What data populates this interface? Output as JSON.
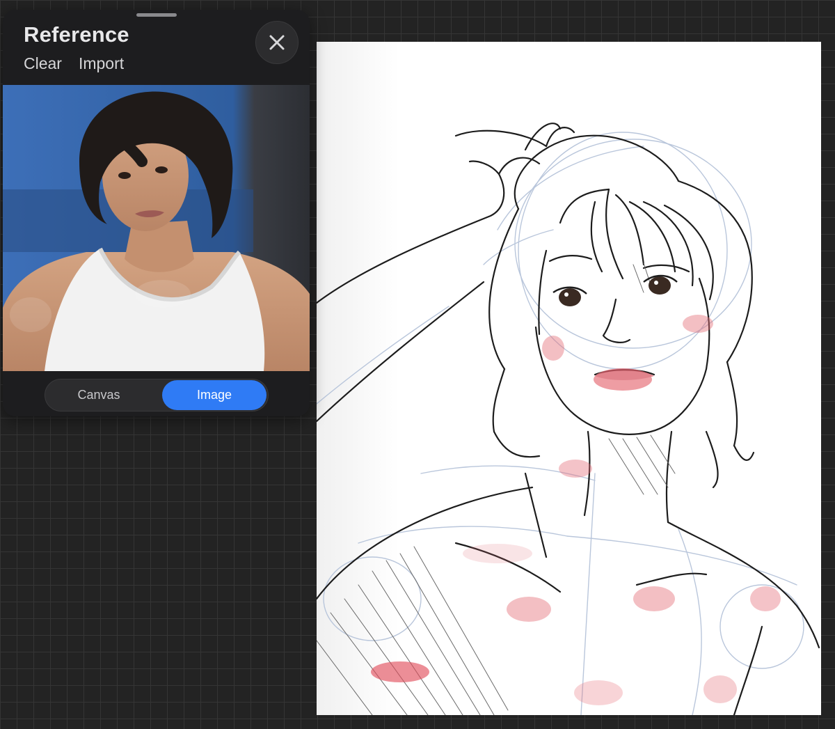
{
  "reference_panel": {
    "title": "Reference",
    "actions": [
      {
        "label": "Clear"
      },
      {
        "label": "Import"
      }
    ],
    "close_icon": "close-icon",
    "segmented_control": {
      "options": [
        {
          "label": "Canvas",
          "selected": false
        },
        {
          "label": "Image",
          "selected": true
        }
      ]
    }
  },
  "colors": {
    "accent": "#2f7bf5",
    "workspace_background": "#232323",
    "panel_background": "#1d1d1f",
    "canvas_background": "#ffffff"
  }
}
